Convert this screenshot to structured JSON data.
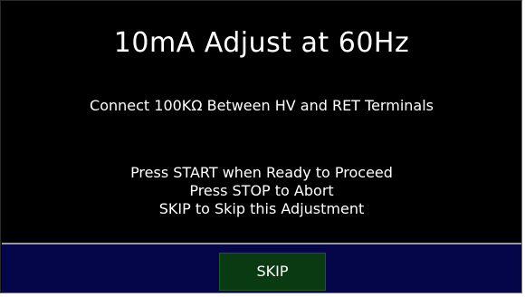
{
  "screen": {
    "title": "10mA Adjust at 60Hz",
    "instruction": "Connect 100KΩ Between HV and RET Terminals",
    "prompts": [
      "Press START when Ready to Proceed",
      "Press STOP to Abort",
      "SKIP to Skip this Adjustment"
    ]
  },
  "footer": {
    "skip_label": "SKIP"
  },
  "colors": {
    "panel_background": "#000000",
    "footer_background": "#05054a",
    "skip_button_background": "#0a3a12",
    "text": "#ffffff"
  }
}
